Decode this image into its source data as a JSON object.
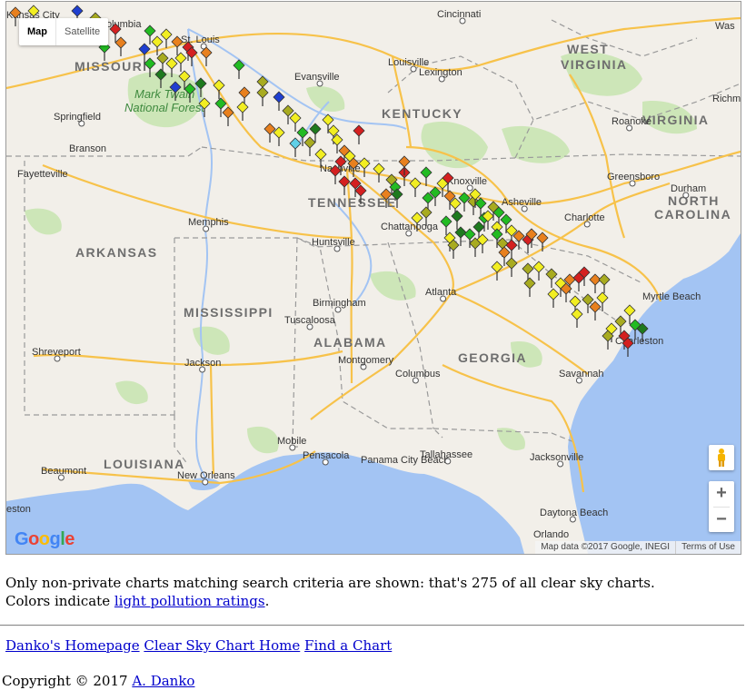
{
  "map": {
    "map_type_buttons": [
      "Map",
      "Satellite"
    ],
    "states": [
      {
        "name": "MISSOURI",
        "kind": "state"
      },
      {
        "name": "KENTUCKY",
        "kind": "state"
      },
      {
        "name": "WEST",
        "kind": "state"
      },
      {
        "name": "VIRGINIA",
        "kind": "state"
      },
      {
        "name": "VIRGINIA",
        "kind": "state"
      },
      {
        "name": "TENNESSEE",
        "kind": "state"
      },
      {
        "name": "NORTH",
        "kind": "state"
      },
      {
        "name": "CAROLINA",
        "kind": "state"
      },
      {
        "name": "ARKANSAS",
        "kind": "state"
      },
      {
        "name": "MISSISSIPPI",
        "kind": "state"
      },
      {
        "name": "ALABAMA",
        "kind": "state"
      },
      {
        "name": "GEORGIA",
        "kind": "state"
      },
      {
        "name": "LOUISIANA",
        "kind": "state"
      }
    ],
    "cities": [
      "Cincinnati",
      "Columbia",
      "St. Louis",
      "Louisville",
      "Lexington",
      "Evansville",
      "Springfield",
      "Branson",
      "Roanoke",
      "Richm",
      "Was",
      "Fayetteville",
      "Knoxville",
      "Asheville",
      "Greensboro",
      "Durham",
      "Charlotte",
      "Memphis",
      "Huntsville",
      "Chattanooga",
      "Atlanta",
      "Birmingham",
      "Tuscaloosa",
      "Shreveport",
      "Jackson",
      "Montgomery",
      "Columbus",
      "Savannah",
      "Myrtle Beach",
      "Charleston",
      "Mobile",
      "Pensacola",
      "Panama City Beach",
      "Tallahassee",
      "Jacksonville",
      "Beaumont",
      "New Orleans",
      "Daytona Beach",
      "Orlando",
      "eston",
      "Nashville",
      "Kansas City"
    ],
    "forest_label": [
      "Mark Twain",
      "National Forest"
    ],
    "google_logo": "Google",
    "attribution": "Map data ©2017 Google, INEGI",
    "terms": "Terms of Use",
    "zoom_in": "+",
    "zoom_out": "−",
    "marker_colors": {
      "red": "#d42020",
      "orange": "#e8801e",
      "yellow": "#f2ee22",
      "olive": "#a8ab20",
      "green": "#22bb22",
      "dark_green": "#1e7a1e",
      "blue": "#1f3fd0",
      "cyan": "#5fd0e8"
    }
  },
  "info": {
    "line1": "Only non-private charts matching search criteria are shown: that's 275 of all clear sky charts.",
    "line2_prefix": "Colors indicate ",
    "line2_link": "light pollution ratings",
    "line2_suffix": "."
  },
  "links": [
    "Danko's Homepage",
    "Clear Sky Chart Home",
    "Find a Chart"
  ],
  "copyright": {
    "prefix": "Copyright © 2017 ",
    "author": "A. Danko"
  }
}
